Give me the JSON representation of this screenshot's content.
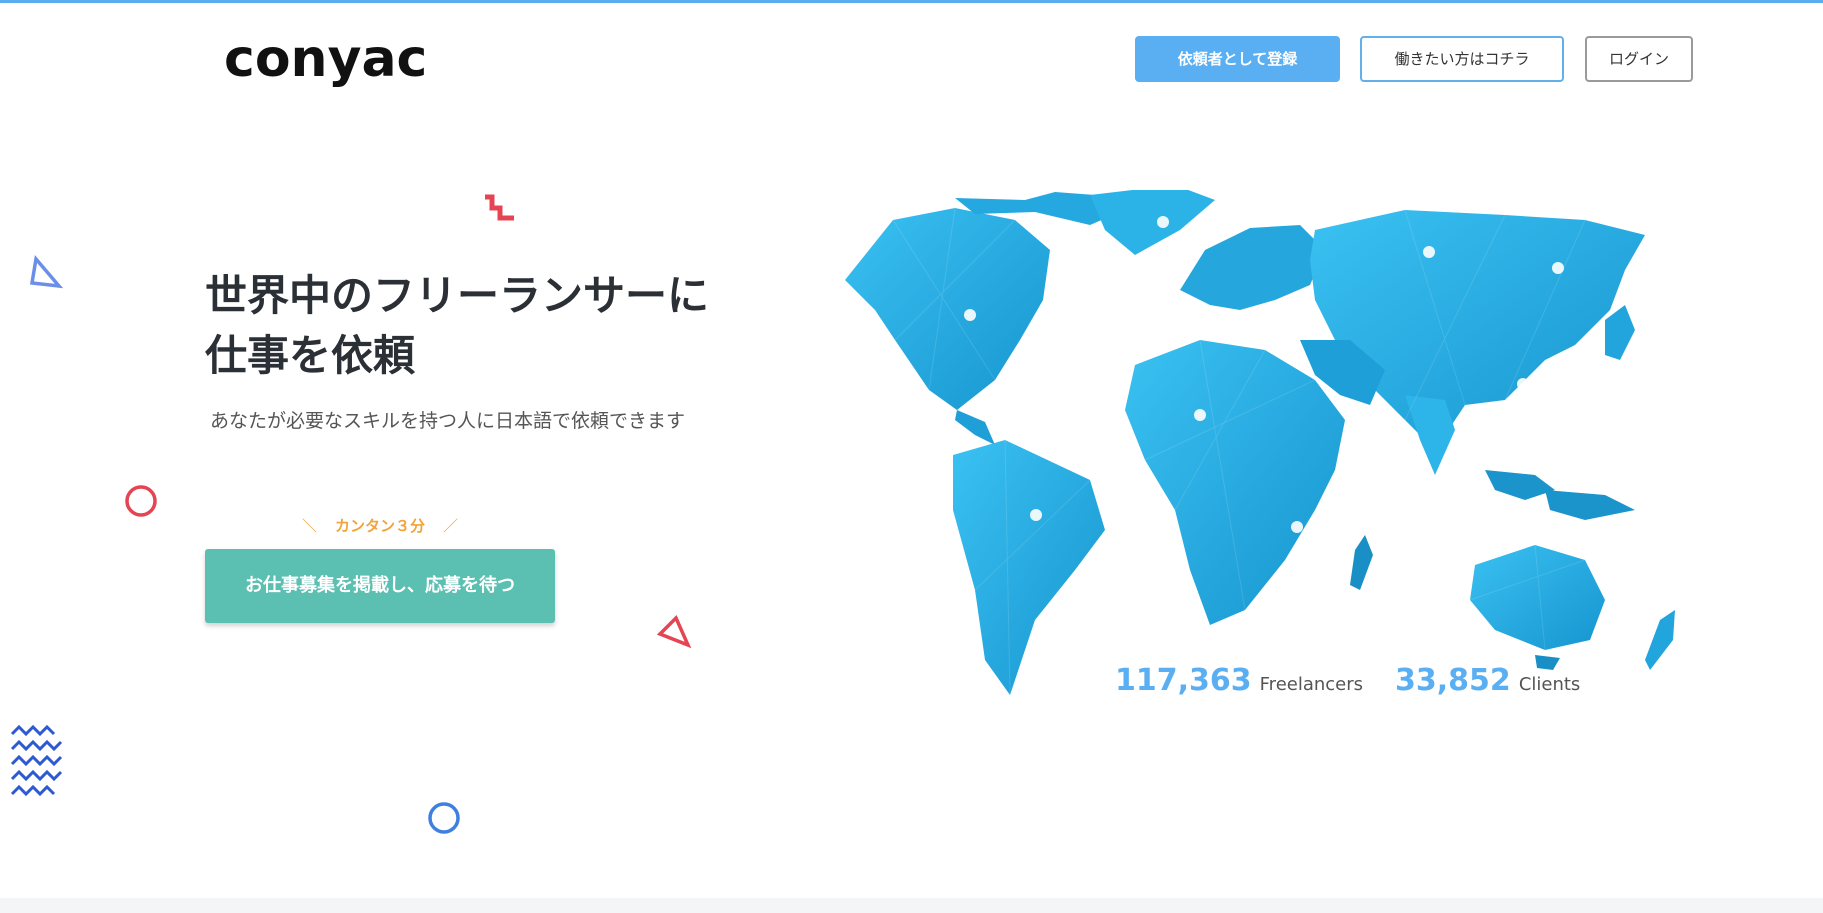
{
  "brand": {
    "name": "conyac",
    "accent_color": "#5aaef2",
    "cta_color": "#5bbfb1",
    "note_color": "#f0a43a"
  },
  "header": {
    "register_client_label": "依頼者として登録",
    "work_label": "働きたい方はコチラ",
    "login_label": "ログイン"
  },
  "hero": {
    "headline_line1": "世界中のフリーランサーに",
    "headline_line2": "仕事を依頼",
    "subline": "あなたが必要なスキルを持つ人に日本語で依頼できます",
    "cta_note": "カンタン３分",
    "cta_label": "お仕事募集を掲載し、応募を待つ"
  },
  "stats": {
    "freelancers_count": "117,363",
    "freelancers_label": "Freelancers",
    "clients_count": "33,852",
    "clients_label": "Clients"
  },
  "icons": {
    "map": "world-map-icon",
    "markers": "location-dot-icon"
  }
}
